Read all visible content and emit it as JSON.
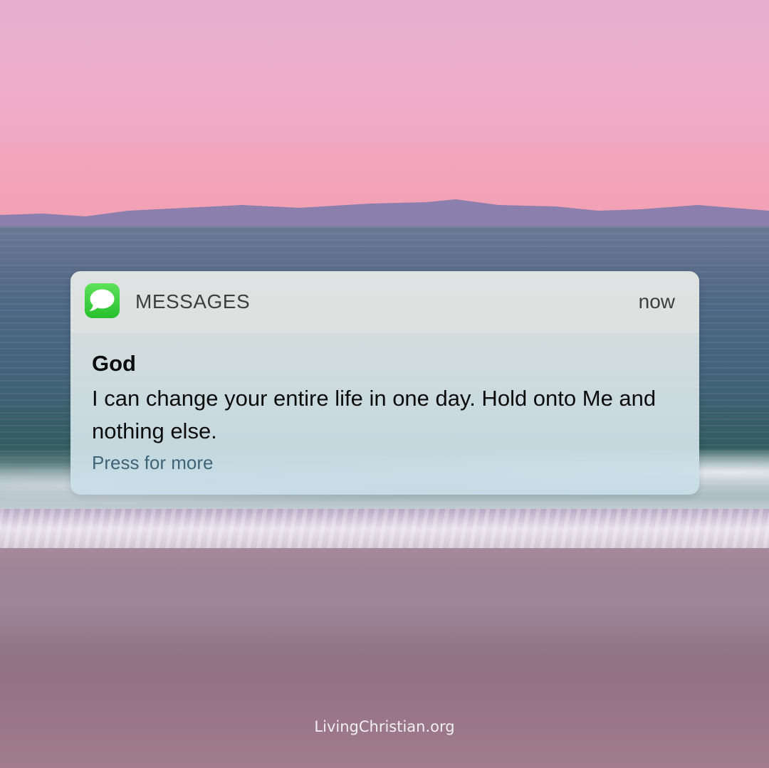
{
  "notification": {
    "app_name": "MESSAGES",
    "app_icon": "messages-bubble-icon",
    "timestamp": "now",
    "sender": "God",
    "message": "I can change your entire life in one day. Hold onto Me and nothing else.",
    "action_hint": "Press for more"
  },
  "watermark": "LivingChristian.org",
  "colors": {
    "icon_green": "#34c63a",
    "hint_text": "#3f6478",
    "sky_pink": "#f2a6bf"
  }
}
